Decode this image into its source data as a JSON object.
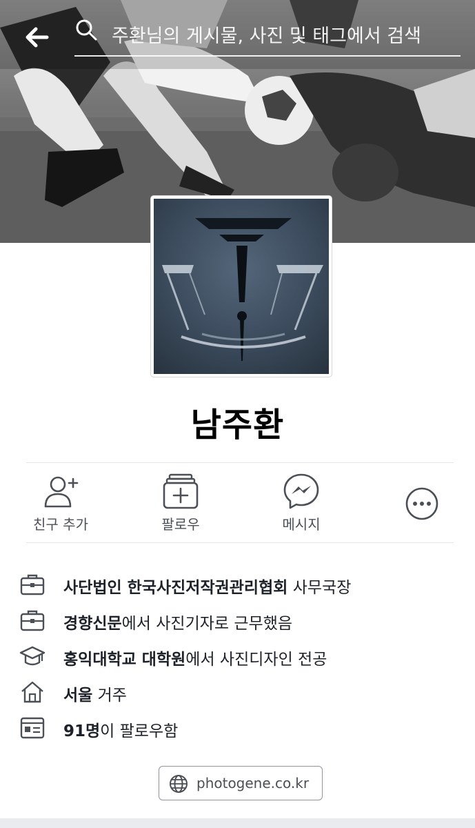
{
  "header": {
    "back_icon": "back-arrow-icon",
    "search_icon": "search-icon",
    "search_placeholder": "주환님의 게시물, 사진 및 태그에서 검색"
  },
  "profile": {
    "name": "남주환",
    "cover_icon": "cover-photo",
    "avatar_icon": "avatar"
  },
  "actions": {
    "add_friend": {
      "label": "친구 추가",
      "icon": "add-friend-icon"
    },
    "follow": {
      "label": "팔로우",
      "icon": "follow-icon"
    },
    "message": {
      "label": "메시지",
      "icon": "messenger-icon"
    },
    "more": {
      "icon": "more-icon"
    }
  },
  "intro": {
    "work1": {
      "bold": "사단법인 한국사진저작권관리협회",
      "rest": " 사무국장",
      "icon": "briefcase-icon"
    },
    "work2": {
      "bold": "경향신문",
      "rest": "에서 사진기자로 근무했음",
      "icon": "briefcase-icon"
    },
    "education": {
      "bold": "홍익대학교 대학원",
      "rest": "에서 사진디자인 전공",
      "icon": "graduation-cap-icon"
    },
    "residence": {
      "bold": "서울",
      "rest": " 거주",
      "icon": "home-icon"
    },
    "followers": {
      "bold": "91명",
      "rest": "이 팔로우함",
      "icon": "followers-card-icon"
    }
  },
  "website": {
    "label": "photogene.co.kr",
    "icon": "globe-icon"
  },
  "colors": {
    "icon_gray": "#4b4f56",
    "text": "#1d2129",
    "divider": "#e5e6ea",
    "background": "#ffffff"
  }
}
